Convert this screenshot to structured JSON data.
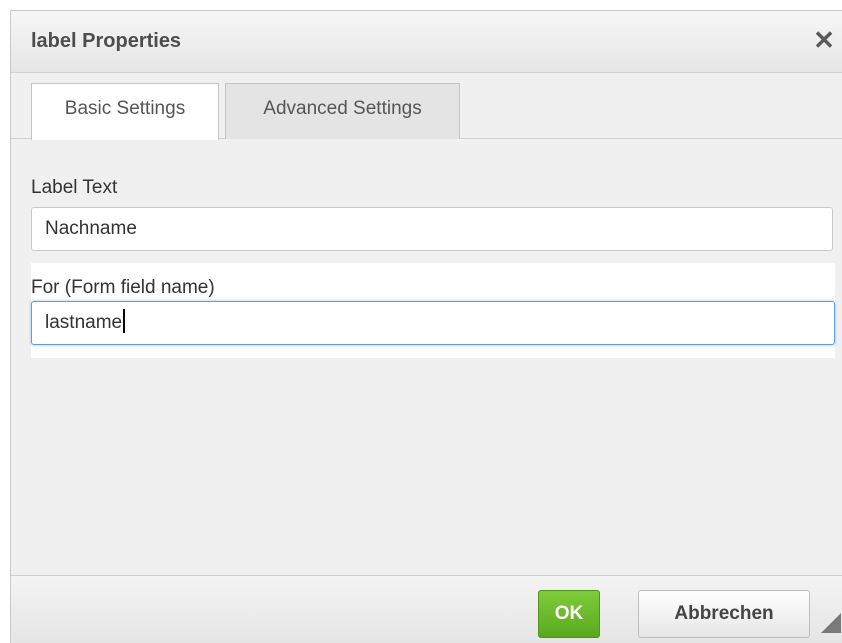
{
  "dialog": {
    "title": "label Properties",
    "close_symbol": "✕"
  },
  "tabs": [
    {
      "label": "Basic Settings",
      "active": true
    },
    {
      "label": "Advanced Settings",
      "active": false
    }
  ],
  "fields": {
    "label_text": {
      "label": "Label Text",
      "value": "Nachname"
    },
    "for_field": {
      "label": "For (Form field name)",
      "value": "lastname"
    }
  },
  "buttons": {
    "ok": "OK",
    "cancel": "Abbrechen"
  },
  "colors": {
    "ok_button": "#6bbd2b",
    "focus_border": "#5b9de6"
  },
  "icons": {
    "close": "close-icon",
    "resize": "resize-grip-icon"
  }
}
